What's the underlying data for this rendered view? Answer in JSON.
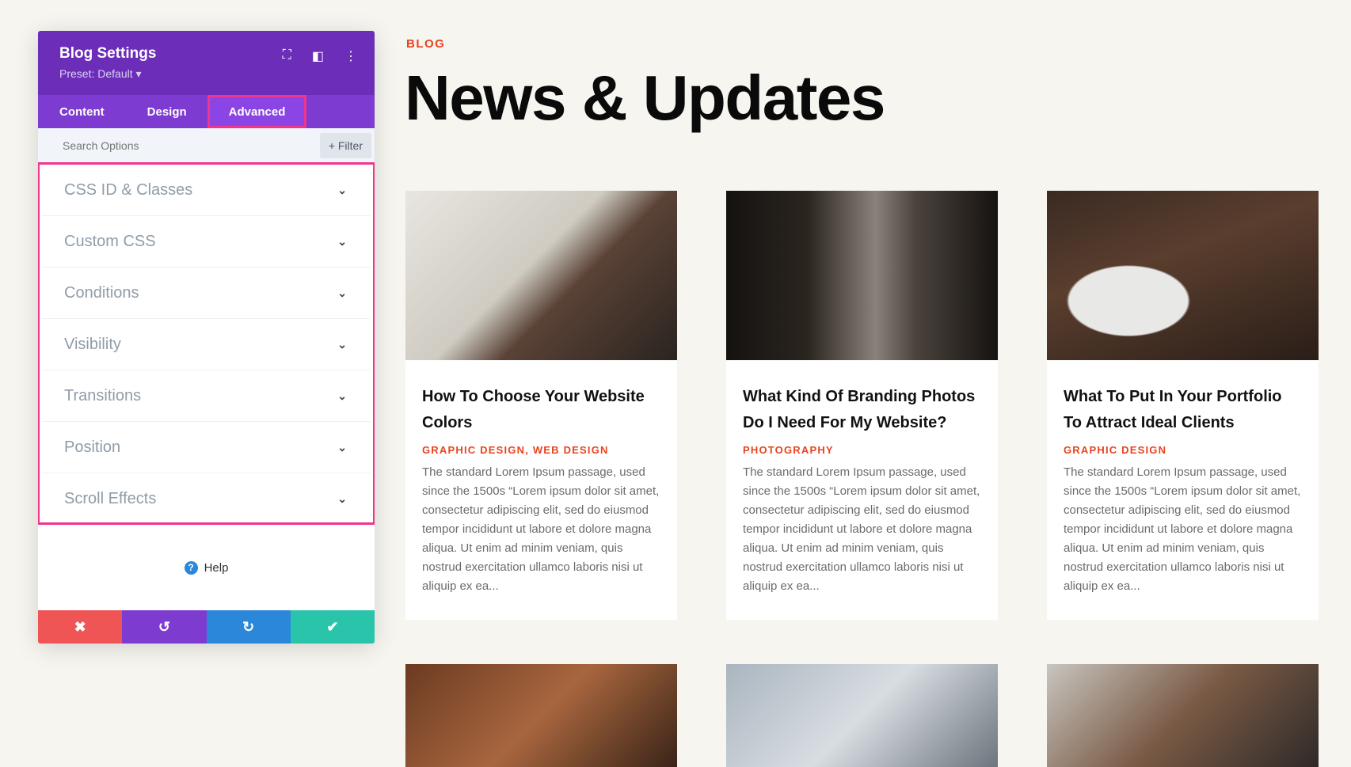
{
  "panel": {
    "title": "Blog Settings",
    "preset": "Preset: Default ▾",
    "tabs": [
      {
        "label": "Content"
      },
      {
        "label": "Design"
      },
      {
        "label": "Advanced"
      }
    ],
    "search_placeholder": "Search Options",
    "filter_label": "+ Filter",
    "options": [
      {
        "label": "CSS ID & Classes"
      },
      {
        "label": "Custom CSS"
      },
      {
        "label": "Conditions"
      },
      {
        "label": "Visibility"
      },
      {
        "label": "Transitions"
      },
      {
        "label": "Position"
      },
      {
        "label": "Scroll Effects"
      }
    ],
    "help_label": "Help",
    "action_colors": {
      "cancel": "#ef5555",
      "undo": "#7e3bd0",
      "redo": "#2b87da",
      "save": "#29c4a9"
    }
  },
  "page": {
    "eyebrow": "BLOG",
    "title": "News & Updates",
    "posts": [
      {
        "title": "How To Choose Your Website Colors",
        "category": "GRAPHIC DESIGN, WEB DESIGN",
        "excerpt": "The standard Lorem Ipsum passage, used since the 1500s “Lorem ipsum dolor sit amet, consectetur adipiscing elit, sed do eiusmod tempor incididunt ut labore et dolore magna aliqua. Ut enim ad minim veniam, quis nostrud exercitation ullamco laboris nisi ut aliquip ex ea..."
      },
      {
        "title": "What Kind Of Branding Photos Do I Need For My Website?",
        "category": "PHOTOGRAPHY",
        "excerpt": "The standard Lorem Ipsum passage, used since the 1500s “Lorem ipsum dolor sit amet, consectetur adipiscing elit, sed do eiusmod tempor incididunt ut labore et dolore magna aliqua. Ut enim ad minim veniam, quis nostrud exercitation ullamco laboris nisi ut aliquip ex ea..."
      },
      {
        "title": "What To Put In Your Portfolio To Attract Ideal Clients",
        "category": "GRAPHIC DESIGN",
        "excerpt": "The standard Lorem Ipsum passage, used since the 1500s “Lorem ipsum dolor sit amet, consectetur adipiscing elit, sed do eiusmod tempor incididunt ut labore et dolore magna aliqua. Ut enim ad minim veniam, quis nostrud exercitation ullamco laboris nisi ut aliquip ex ea..."
      }
    ]
  }
}
